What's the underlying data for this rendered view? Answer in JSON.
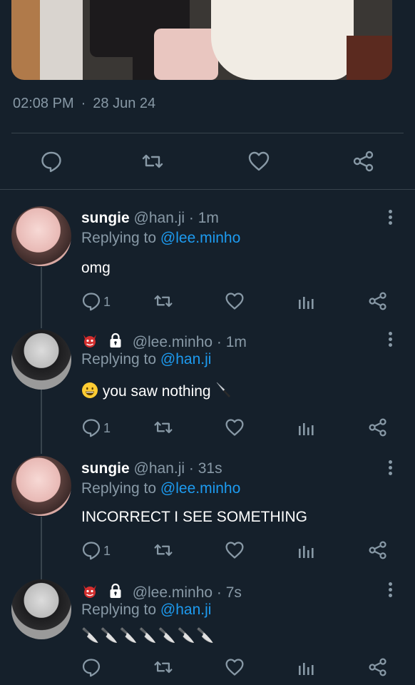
{
  "tweet": {
    "time": "02:08 PM",
    "separator": "·",
    "date": "28 Jun 24"
  },
  "actions": [
    "reply-icon",
    "retweet-icon",
    "like-icon",
    "share-icon"
  ],
  "replies": [
    {
      "name": "sungie",
      "handle": "@han.ji",
      "age": "· 1m",
      "replying_prefix": "Replying to",
      "replying_to": "@lee.minho",
      "text": "omg",
      "reply_count": "1"
    },
    {
      "name": "",
      "handle": "@lee.minho",
      "age": "· 1m",
      "replying_prefix": "Replying to",
      "replying_to": "@han.ji",
      "text": "you saw nothing",
      "reply_count": "1"
    },
    {
      "name": "sungie",
      "handle": "@han.ji",
      "age": "· 31s",
      "replying_prefix": "Replying to",
      "replying_to": "@lee.minho",
      "text": "INCORRECT I SEE SOMETHING",
      "reply_count": "1"
    },
    {
      "name": "",
      "handle": "@lee.minho",
      "age": "· 7s",
      "replying_prefix": "Replying to",
      "replying_to": "@han.ji",
      "text": "🔪🔪🔪🔪🔪🔪🔪",
      "reply_count": ""
    }
  ],
  "colors": {
    "background": "#15202b",
    "muted": "#8899a6",
    "link": "#1d9bf0",
    "divider": "#38444d"
  }
}
